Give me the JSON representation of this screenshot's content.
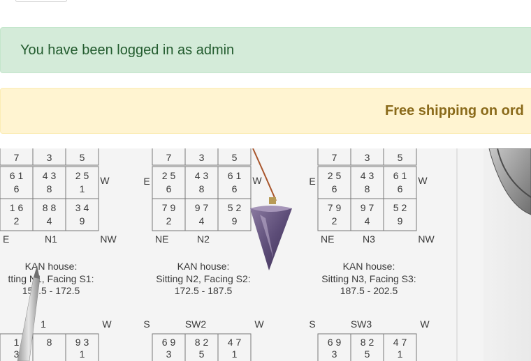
{
  "alerts": {
    "login_message": "You have been logged in as admin",
    "promo_message": "Free shipping on ord"
  },
  "hero": {
    "alt": "Feng shui flying star charts with amethyst pendulum and pen",
    "charts": [
      {
        "top_row": [
          "7",
          "3",
          "5"
        ],
        "grid": [
          [
            "6 1",
            "4 3",
            "2 5"
          ],
          [
            "6",
            "8",
            "1"
          ],
          [
            "1 6",
            "8 8",
            "3 4"
          ],
          [
            "2",
            "4",
            "9"
          ]
        ],
        "left_label": "",
        "right_label": "W",
        "bottom_left": "E",
        "bottom_mid": "N1",
        "bottom_right": "NW",
        "house": "KAN house:",
        "sitting": "tting N1, Facing S1:",
        "degrees": "157.5 - 172.5"
      },
      {
        "top_row": [
          "7",
          "3",
          "5"
        ],
        "grid": [
          [
            "2 5",
            "4 3",
            "6 1"
          ],
          [
            "6",
            "8",
            "6"
          ],
          [
            "7 9",
            "9 7",
            "5 2"
          ],
          [
            "2",
            "4",
            "9"
          ]
        ],
        "left_label": "E",
        "right_label": "W",
        "bottom_left": "NE",
        "bottom_mid": "N2",
        "bottom_right": "",
        "house": "KAN house:",
        "sitting": "Sitting N2, Facing S2:",
        "degrees": "172.5 - 187.5"
      },
      {
        "top_row": [
          "7",
          "3",
          "5"
        ],
        "grid": [
          [
            "2 5",
            "4 3",
            "6 1"
          ],
          [
            "6",
            "8",
            "6"
          ],
          [
            "7 9",
            "9 7",
            "5 2"
          ],
          [
            "2",
            "4",
            "9"
          ]
        ],
        "left_label": "E",
        "right_label": "W",
        "bottom_left": "NE",
        "bottom_mid": "N3",
        "bottom_right": "NW",
        "house": "KAN house:",
        "sitting": "Sitting N3, Facing S3:",
        "degrees": "187.5 - 202.5"
      }
    ],
    "lower_charts": [
      {
        "left": "",
        "mid": "1",
        "right": "W",
        "cells": [
          "1",
          "8",
          "9 3"
        ],
        "sub": [
          "3",
          "",
          "1"
        ]
      },
      {
        "left": "S",
        "mid": "SW2",
        "right": "W",
        "cells": [
          "6 9",
          "8 2",
          "4 7"
        ],
        "sub": [
          "3",
          "5",
          "1"
        ]
      },
      {
        "left": "S",
        "mid": "SW3",
        "right": "W",
        "cells": [
          "6 9",
          "8 2",
          "4 7"
        ],
        "sub": [
          "3",
          "5",
          "1"
        ]
      }
    ]
  }
}
